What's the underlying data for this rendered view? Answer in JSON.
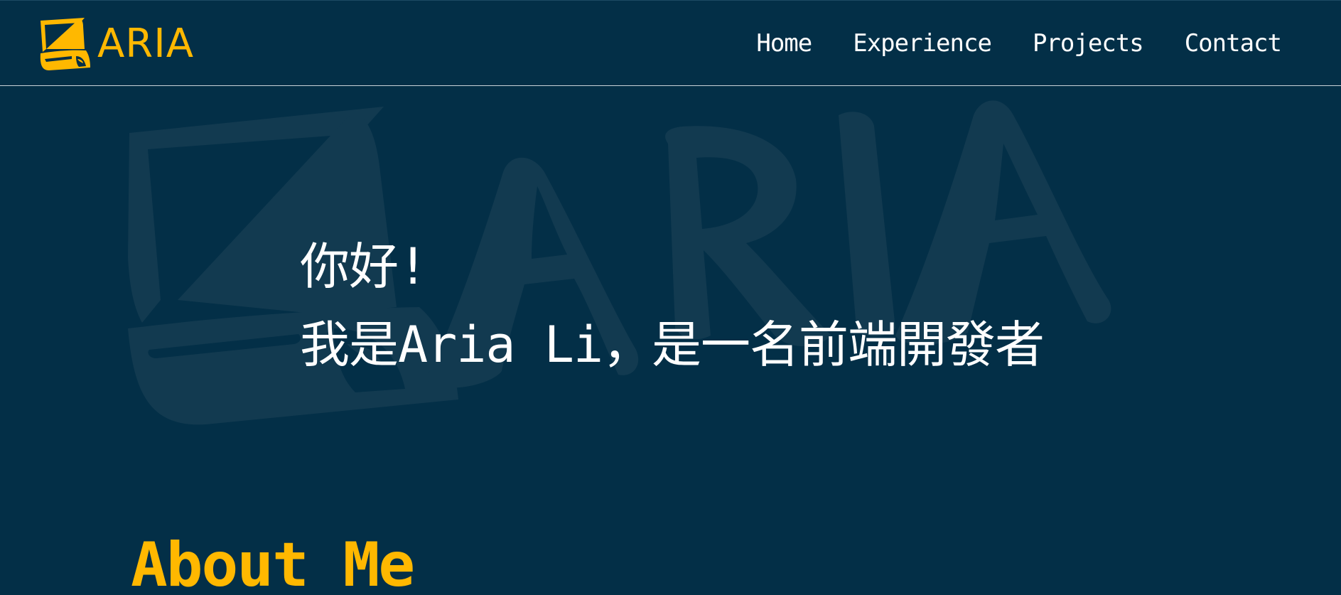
{
  "header": {
    "brand_name": "ARIA",
    "brand_icon": "laptop-logo-icon",
    "nav": [
      {
        "label": "Home"
      },
      {
        "label": "Experience"
      },
      {
        "label": "Projects"
      },
      {
        "label": "Contact"
      }
    ]
  },
  "hero": {
    "greeting_line1": "你好!",
    "greeting_line2": "我是Aria Li，是一名前端開發者",
    "watermark_text": "ARIA"
  },
  "about": {
    "heading": "About Me"
  },
  "colors": {
    "background": "#032f47",
    "accent": "#ffb800",
    "text": "#ffffff",
    "watermark": "#123a50"
  }
}
